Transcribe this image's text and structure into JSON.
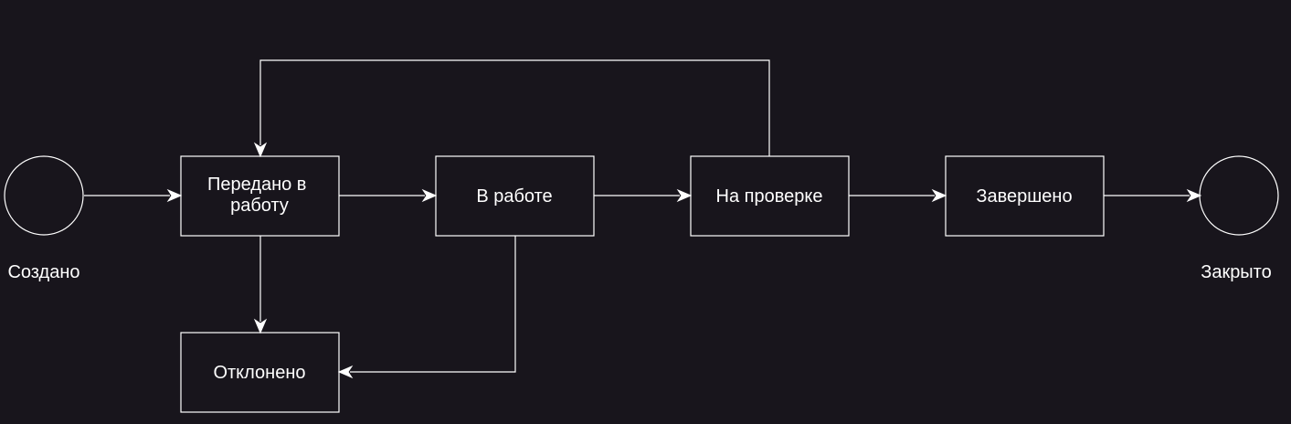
{
  "diagram": {
    "type": "state-flow",
    "colors": {
      "background": "#18151c",
      "stroke": "#ffffff",
      "text": "#ffffff"
    },
    "nodes": {
      "created": {
        "shape": "circle",
        "label": "Создано"
      },
      "assigned": {
        "shape": "rect",
        "label_line1": "Передано в",
        "label_line2": "работу"
      },
      "in_progress": {
        "shape": "rect",
        "label": "В работе"
      },
      "on_review": {
        "shape": "rect",
        "label": "На проверке"
      },
      "completed": {
        "shape": "rect",
        "label": "Завершено"
      },
      "closed": {
        "shape": "circle",
        "label": "Закрыто"
      },
      "rejected": {
        "shape": "rect",
        "label": "Отклонено"
      }
    },
    "edges": [
      {
        "from": "Создано",
        "to": "Передано в работу"
      },
      {
        "from": "Передано в работу",
        "to": "В работе"
      },
      {
        "from": "В работе",
        "to": "На проверке"
      },
      {
        "from": "На проверке",
        "to": "Завершено"
      },
      {
        "from": "Завершено",
        "to": "Закрыто"
      },
      {
        "from": "На проверке",
        "to": "Передано в работу"
      },
      {
        "from": "Передано в работу",
        "to": "Отклонено"
      },
      {
        "from": "В работе",
        "to": "Отклонено"
      }
    ]
  }
}
